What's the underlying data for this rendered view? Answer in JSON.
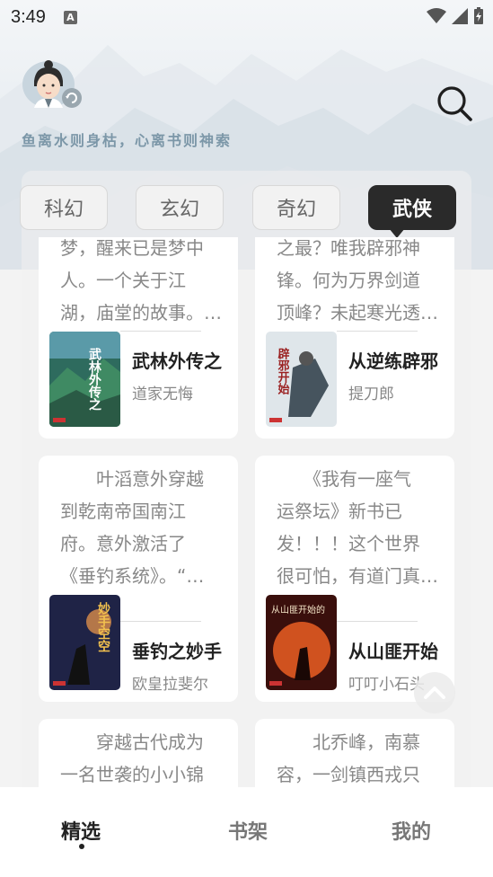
{
  "status_bar": {
    "time": "3:49",
    "notif_letter": "A"
  },
  "header": {
    "motto": "鱼离水则身枯，心离书则神索",
    "search_icon": "search-icon",
    "avatar_icon": "avatar-refresh-icon"
  },
  "tabs": [
    {
      "label": "科幻",
      "active": false
    },
    {
      "label": "玄幻",
      "active": false
    },
    {
      "label": "奇幻",
      "active": false
    },
    {
      "label": "武侠",
      "active": true
    }
  ],
  "books": [
    {
      "desc": [
        "梦，醒来已是梦中",
        "人。一个关于江",
        "湖，庙堂的故事。…"
      ],
      "title": "武林外传之",
      "author": "道家无悔",
      "cover_text": "武林外传之"
    },
    {
      "desc": [
        "之最？唯我辟邪神",
        "锋。何为万界剑道",
        "顶峰？未起寒光透…"
      ],
      "title": "从逆练辟邪",
      "author": "提刀郎",
      "cover_text": "辟邪开始"
    },
    {
      "desc": [
        "　　叶滔意外穿越",
        "到乾南帝国南江",
        "府。意外激活了",
        "《垂钓系统》。“…"
      ],
      "title": "垂钓之妙手",
      "author": "欧皇拉斐尔",
      "cover_text": "妙手空空"
    },
    {
      "desc": [
        "　　《我有一座气",
        "运祭坛》新书已",
        "发！！！这个世界",
        "很可怕，有道门真…"
      ],
      "title": "从山匪开始",
      "author": "叮叮小石头",
      "cover_text": "从山匪开始的"
    },
    {
      "desc": [
        "　　穿越古代成为",
        "一名世袭的小小锦"
      ],
      "title": "",
      "author": "",
      "cover_text": ""
    },
    {
      "desc": [
        "　　北乔峰，南慕",
        "容，一剑镇西戎只"
      ],
      "title": "",
      "author": "",
      "cover_text": ""
    }
  ],
  "bottom_nav": [
    {
      "label": "精选",
      "active": true
    },
    {
      "label": "书架",
      "active": false
    },
    {
      "label": "我的",
      "active": false
    }
  ],
  "colors": {
    "accent_dark": "#2a2a2a",
    "motto": "#7c97a8"
  }
}
